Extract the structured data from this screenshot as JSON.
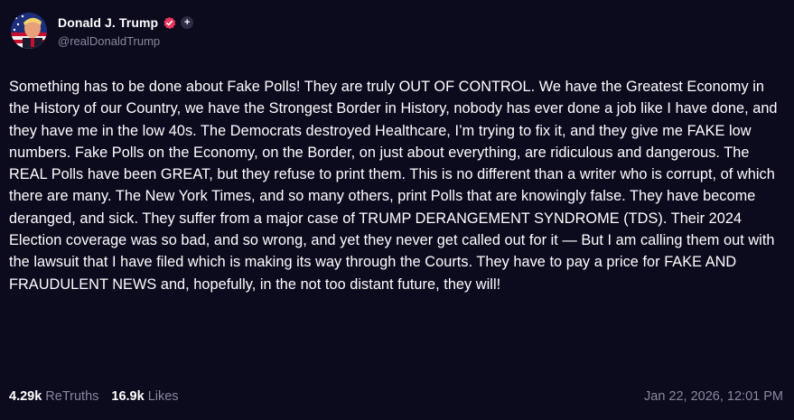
{
  "author": {
    "display_name": "Donald J. Trump",
    "handle": "@realDonaldTrump",
    "verified_icon": "verified-badge-icon",
    "plus_icon": "plus-icon",
    "plus_symbol": "+"
  },
  "post": {
    "text": "Something has to be done about Fake Polls! They are truly OUT OF CONTROL. We have the Greatest Economy in the History of our Country, we have the Strongest Border in History, nobody has ever done a job like I have done, and they have me in the low 40s. The Democrats destroyed Healthcare, I’m trying to fix it, and they give me FAKE low numbers. Fake Polls on the Economy, on the Border, on just about everything, are ridiculous and dangerous. The REAL Polls have been GREAT, but they refuse to print them. This is no different than a writer who is corrupt, of which there are many. The New York Times, and so many others, print Polls that are knowingly false. They have become deranged, and sick. They suffer from a major case of TRUMP DERANGEMENT SYNDROME (TDS). Their 2024 Election coverage was so bad, and so wrong, and yet they never get called out for it — But I am calling them out with the lawsuit that I have filed which is making its way through the Courts. They have to pay a price for FAKE AND FRAUDULENT NEWS and, hopefully, in the not too distant future, they will!"
  },
  "stats": {
    "retruths_count": "4.29k",
    "retruths_label": "ReTruths",
    "likes_count": "16.9k",
    "likes_label": "Likes"
  },
  "timestamp": "Jan 22, 2026, 12:01 PM",
  "colors": {
    "background": "#0c0a1d",
    "text": "#ffffff",
    "muted": "#8a879e",
    "verified": "#e8365d"
  }
}
